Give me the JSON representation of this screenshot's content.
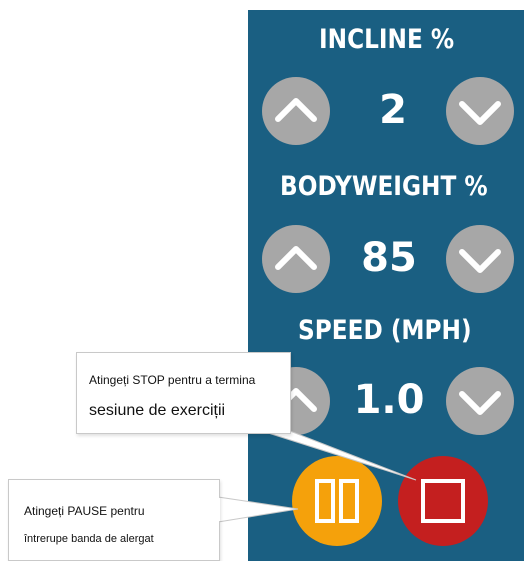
{
  "controls": {
    "incline": {
      "label": "INCLINE %",
      "value": "2"
    },
    "bodyweight": {
      "label": "BODYWEIGHT %",
      "value": "85"
    },
    "speed": {
      "label": "SPEED (MPH)",
      "value": "1.0"
    }
  },
  "callouts": {
    "stop": {
      "line1": "Atingeți STOP pentru a termina",
      "line2": "sesiune de exerciții"
    },
    "pause": {
      "line1": "Atingeți PAUSE pentru",
      "line2": "întrerupe banda de alergat"
    }
  },
  "icons": {
    "increase": "chevron-up-icon",
    "decrease": "chevron-down-icon",
    "pause": "pause-icon",
    "stop": "stop-icon"
  },
  "colors": {
    "panel": "#1a5f82",
    "round_button": "#a7a7a7",
    "pause_button": "#f5a10b",
    "stop_button": "#c41f1f",
    "text": "#ffffff"
  }
}
